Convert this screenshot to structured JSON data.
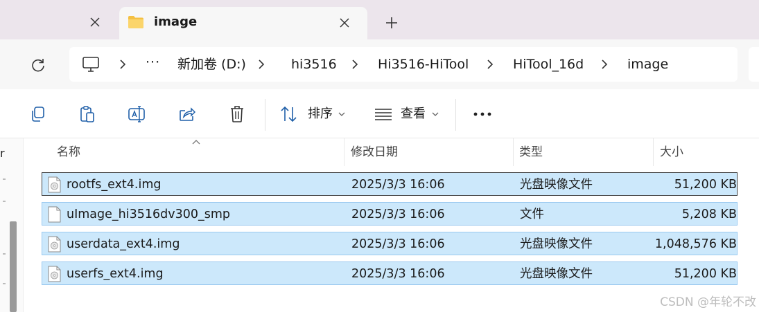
{
  "tabs": {
    "active_title": "image"
  },
  "address": {
    "overflow": "···",
    "breadcrumbs": [
      "新加卷 (D:)",
      "hi3516",
      "Hi3516-HiTool",
      "HiTool_16d",
      "image"
    ]
  },
  "toolbar": {
    "sort_label": "排序",
    "view_label": "查看"
  },
  "pane": {
    "letter": "r"
  },
  "columns": {
    "name": "名称",
    "modified": "修改日期",
    "type": "类型",
    "size": "大小"
  },
  "files": [
    {
      "name": "rootfs_ext4.img",
      "modified": "2025/3/3 16:06",
      "type": "光盘映像文件",
      "size": "51,200 KB",
      "icon": "disc-image-icon"
    },
    {
      "name": "uImage_hi3516dv300_smp",
      "modified": "2025/3/3 16:06",
      "type": "文件",
      "size": "5,208 KB",
      "icon": "file-icon"
    },
    {
      "name": "userdata_ext4.img",
      "modified": "2025/3/3 16:06",
      "type": "光盘映像文件",
      "size": "1,048,576 KB",
      "icon": "disc-image-icon"
    },
    {
      "name": "userfs_ext4.img",
      "modified": "2025/3/3 16:06",
      "type": "光盘映像文件",
      "size": "51,200 KB",
      "icon": "disc-image-icon"
    }
  ],
  "watermark": "CSDN @年轮不改",
  "colors": {
    "tabstrip": "#ece5ec",
    "selection": "#cce8fb",
    "selection_border": "#99c8ef",
    "folder_yellow": "#f4c042"
  }
}
